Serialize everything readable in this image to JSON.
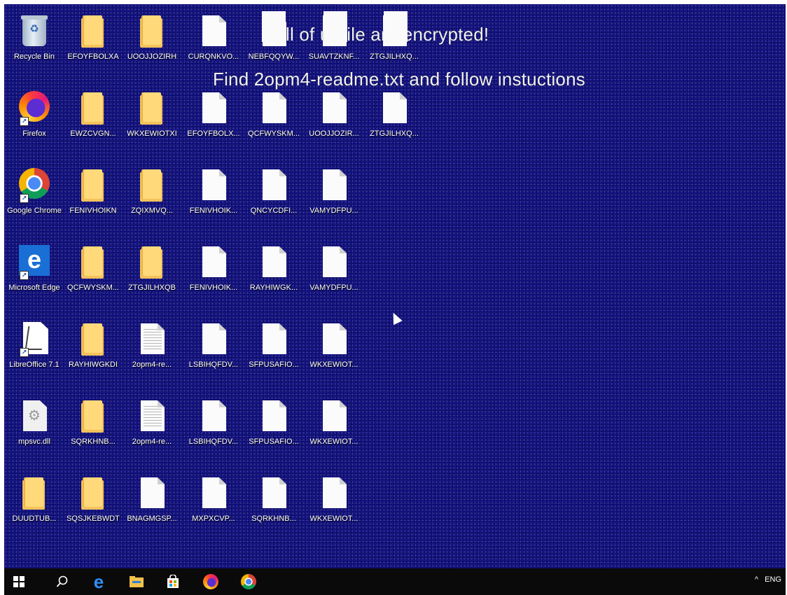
{
  "wallpaper_notice": {
    "line1": "ll of    ur file   are encrypted!",
    "line2": "Find 2opm4-readme.txt and follow instuctions"
  },
  "desktop_icons": [
    {
      "label": "Recycle Bin",
      "kind": "recycle-bin"
    },
    {
      "label": "EFOYFBOLXA",
      "kind": "folder"
    },
    {
      "label": "UOOJJOZIRH",
      "kind": "folder"
    },
    {
      "label": "CURQNKVO...",
      "kind": "file"
    },
    {
      "label": "NEBFQQYW...",
      "kind": "file"
    },
    {
      "label": "SUAVTZKNF...",
      "kind": "file"
    },
    {
      "label": "ZTGJILHXQ...",
      "kind": "file"
    },
    {
      "label": "Firefox",
      "kind": "firefox"
    },
    {
      "label": "EWZCVGN...",
      "kind": "folder"
    },
    {
      "label": "WKXEWIOTXI",
      "kind": "folder"
    },
    {
      "label": "EFOYFBOLX...",
      "kind": "file"
    },
    {
      "label": "QCFWYSKM...",
      "kind": "file"
    },
    {
      "label": "UOOJJOZIR...",
      "kind": "file"
    },
    {
      "label": "ZTGJILHXQ...",
      "kind": "file"
    },
    {
      "label": "Google Chrome",
      "kind": "chrome"
    },
    {
      "label": "FENIVHOIKN",
      "kind": "folder"
    },
    {
      "label": "ZQIXMVQ...",
      "kind": "folder"
    },
    {
      "label": "FENIVHOIK...",
      "kind": "file"
    },
    {
      "label": "QNCYCDFI...",
      "kind": "file"
    },
    {
      "label": "VAMYDFPU...",
      "kind": "file"
    },
    {
      "label": "Microsoft Edge",
      "kind": "edge"
    },
    {
      "label": "QCFWYSKM...",
      "kind": "folder"
    },
    {
      "label": "ZTGJILHXQB",
      "kind": "folder"
    },
    {
      "label": "FENIVHOIK...",
      "kind": "file"
    },
    {
      "label": "RAYHIWGK...",
      "kind": "file"
    },
    {
      "label": "VAMYDFPU...",
      "kind": "file"
    },
    {
      "label": "LibreOffice 7.1",
      "kind": "libreoffice"
    },
    {
      "label": "RAYHIWGKDI",
      "kind": "folder"
    },
    {
      "label": "2opm4-re...",
      "kind": "text"
    },
    {
      "label": "LSBIHQFDV...",
      "kind": "file"
    },
    {
      "label": "SFPUSAFIO...",
      "kind": "file"
    },
    {
      "label": "WKXEWIOT...",
      "kind": "file"
    },
    {
      "label": "mpsvc.dll",
      "kind": "dll"
    },
    {
      "label": "SQRKHNB...",
      "kind": "folder"
    },
    {
      "label": "2opm4-re...",
      "kind": "text"
    },
    {
      "label": "LSBIHQFDV...",
      "kind": "file"
    },
    {
      "label": "SFPUSAFIO...",
      "kind": "file"
    },
    {
      "label": "WKXEWIOT...",
      "kind": "file"
    },
    {
      "label": "DUUDTUB...",
      "kind": "folder"
    },
    {
      "label": "SQSJKEBWDT",
      "kind": "folder"
    },
    {
      "label": "BNAGMGSP...",
      "kind": "file"
    },
    {
      "label": "MXPXCVP...",
      "kind": "file"
    },
    {
      "label": "SQRKHNB...",
      "kind": "file"
    },
    {
      "label": "WKXEWIOT...",
      "kind": "file"
    }
  ],
  "taskbar": {
    "items": [
      "start-icon",
      "search-icon",
      "edge-icon",
      "file-explorer-icon",
      "store-icon",
      "firefox-icon",
      "chrome-icon"
    ],
    "tray_chevron": "^",
    "language": "ENG"
  },
  "colors": {
    "wallpaper": "#0b0a73",
    "taskbar": "#0a0a0a",
    "folder": "#ffd97a"
  }
}
